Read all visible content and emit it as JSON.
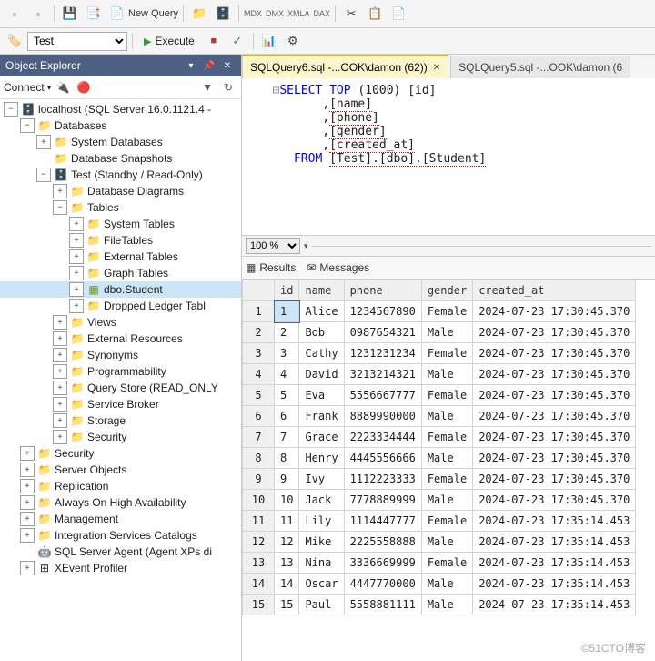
{
  "top": {
    "connection_select": "Test",
    "new_query": "New Query",
    "tool_badges": [
      "MDX",
      "DMX",
      "XMLA",
      "DAX"
    ]
  },
  "toolbar2": {
    "execute": "Execute"
  },
  "object_explorer": {
    "title": "Object Explorer",
    "connect": "Connect",
    "root": "localhost (SQL Server 16.0.1121.4 -",
    "databases": "Databases",
    "sys_db": "System Databases",
    "snap": "Database Snapshots",
    "test_db": "Test (Standby / Read-Only)",
    "diagrams": "Database Diagrams",
    "tables": "Tables",
    "sys_tables": "System Tables",
    "file_tables": "FileTables",
    "ext_tables": "External Tables",
    "graph_tables": "Graph Tables",
    "dbo_student": "dbo.Student",
    "dropped": "Dropped Ledger Tabl",
    "views": "Views",
    "ext_res": "External Resources",
    "synonyms": "Synonyms",
    "prog": "Programmability",
    "qstore": "Query Store (READ_ONLY",
    "sbroker": "Service Broker",
    "storage": "Storage",
    "security_db": "Security",
    "security": "Security",
    "server_obj": "Server Objects",
    "replication": "Replication",
    "aoha": "Always On High Availability",
    "mgmt": "Management",
    "isc": "Integration Services Catalogs",
    "agent": "SQL Server Agent (Agent XPs di",
    "xevent": "XEvent Profiler"
  },
  "tabs": {
    "active": "SQLQuery6.sql -...OOK\\damon (62))",
    "other": "SQLQuery5.sql -...OOK\\damon (6"
  },
  "sql": {
    "select": "SELECT",
    "top": "TOP",
    "topn": "(1000)",
    "cols": [
      "[id]",
      "[name]",
      "[phone]",
      "[gender]",
      "[created_at]"
    ],
    "from": "FROM",
    "src": "[Test].[dbo].[Student]"
  },
  "zoom": "100 %",
  "results_tabs": {
    "results": "Results",
    "messages": "Messages"
  },
  "grid": {
    "cols": [
      "id",
      "name",
      "phone",
      "gender",
      "created_at"
    ],
    "rows": [
      {
        "n": 1,
        "id": 1,
        "name": "Alice",
        "phone": "1234567890",
        "gender": "Female",
        "created_at": "2024-07-23 17:30:45.370"
      },
      {
        "n": 2,
        "id": 2,
        "name": "Bob",
        "phone": "0987654321",
        "gender": "Male",
        "created_at": "2024-07-23 17:30:45.370"
      },
      {
        "n": 3,
        "id": 3,
        "name": "Cathy",
        "phone": "1231231234",
        "gender": "Female",
        "created_at": "2024-07-23 17:30:45.370"
      },
      {
        "n": 4,
        "id": 4,
        "name": "David",
        "phone": "3213214321",
        "gender": "Male",
        "created_at": "2024-07-23 17:30:45.370"
      },
      {
        "n": 5,
        "id": 5,
        "name": "Eva",
        "phone": "5556667777",
        "gender": "Female",
        "created_at": "2024-07-23 17:30:45.370"
      },
      {
        "n": 6,
        "id": 6,
        "name": "Frank",
        "phone": "8889990000",
        "gender": "Male",
        "created_at": "2024-07-23 17:30:45.370"
      },
      {
        "n": 7,
        "id": 7,
        "name": "Grace",
        "phone": "2223334444",
        "gender": "Female",
        "created_at": "2024-07-23 17:30:45.370"
      },
      {
        "n": 8,
        "id": 8,
        "name": "Henry",
        "phone": "4445556666",
        "gender": "Male",
        "created_at": "2024-07-23 17:30:45.370"
      },
      {
        "n": 9,
        "id": 9,
        "name": "Ivy",
        "phone": "1112223333",
        "gender": "Female",
        "created_at": "2024-07-23 17:30:45.370"
      },
      {
        "n": 10,
        "id": 10,
        "name": "Jack",
        "phone": "7778889999",
        "gender": "Male",
        "created_at": "2024-07-23 17:30:45.370"
      },
      {
        "n": 11,
        "id": 11,
        "name": "Lily",
        "phone": "1114447777",
        "gender": "Female",
        "created_at": "2024-07-23 17:35:14.453"
      },
      {
        "n": 12,
        "id": 12,
        "name": "Mike",
        "phone": "2225558888",
        "gender": "Male",
        "created_at": "2024-07-23 17:35:14.453"
      },
      {
        "n": 13,
        "id": 13,
        "name": "Nina",
        "phone": "3336669999",
        "gender": "Female",
        "created_at": "2024-07-23 17:35:14.453"
      },
      {
        "n": 14,
        "id": 14,
        "name": "Oscar",
        "phone": "4447770000",
        "gender": "Male",
        "created_at": "2024-07-23 17:35:14.453"
      },
      {
        "n": 15,
        "id": 15,
        "name": "Paul",
        "phone": "5558881111",
        "gender": "Male",
        "created_at": "2024-07-23 17:35:14.453"
      }
    ]
  },
  "watermark": "©51CTO博客"
}
